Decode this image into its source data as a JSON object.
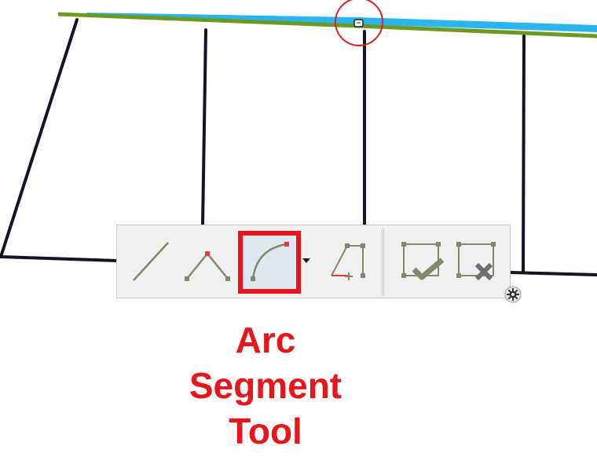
{
  "toolbar": {
    "tools": [
      {
        "id": "line",
        "icon": "straight-segment-icon"
      },
      {
        "id": "vertex",
        "icon": "midpoint-segment-icon"
      },
      {
        "id": "arc",
        "icon": "arc-segment-icon",
        "selected": true
      },
      {
        "id": "right-angle",
        "icon": "right-angle-segment-icon"
      },
      {
        "id": "finish",
        "icon": "finish-sketch-icon"
      },
      {
        "id": "cancel",
        "icon": "cancel-sketch-icon"
      }
    ],
    "dropdown_icon": "chevron-down-icon",
    "settings_icon": "gear-icon"
  },
  "callout": {
    "lines": [
      "Arc",
      "Segment",
      "Tool"
    ],
    "color": "#e8161b"
  },
  "colors": {
    "water": "#2bb5f0",
    "boundary": "#6a9a1f",
    "parcel_lines": "#141426",
    "highlight": "#e8161b",
    "vertex": "#7d8a6c",
    "vertex_active": "#e23a3a"
  }
}
